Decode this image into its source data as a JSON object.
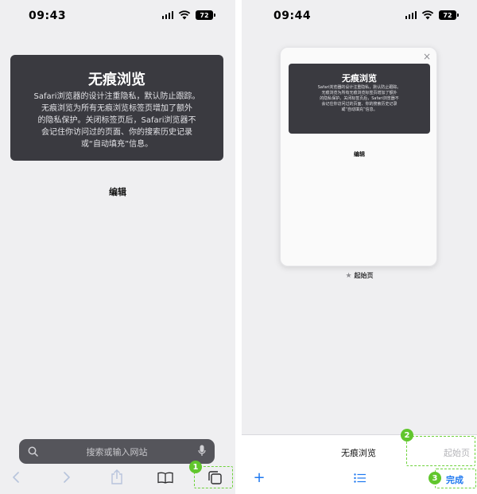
{
  "left": {
    "status": {
      "time": "09:43",
      "battery": "72"
    },
    "card": {
      "title": "无痕浏览",
      "text": "Safari浏览器的设计注重隐私，默认防止跟踪。\n无痕浏览为所有无痕浏览标签页增加了额外\n的隐私保护。关闭标签页后，Safari浏览器不\n会记住你访问过的页面、你的搜索历史记录\n或“自动填充”信息。"
    },
    "edit_label": "编辑",
    "search": {
      "placeholder": "搜索或输入网站"
    },
    "callout": {
      "number": "1"
    }
  },
  "right": {
    "status": {
      "time": "09:44",
      "battery": "72"
    },
    "card": {
      "title": "无痕浏览",
      "text": "Safari浏览器的设计注重隐私，默认防止跟踪。\n无痕浏览为所有无痕浏览标签页增加了额外\n的隐私保护。关闭标签页后，Safari浏览器不\n会记住你访问过的页面、你的搜索历史记录\n或“自动填充”信息。"
    },
    "edit_label": "编辑",
    "close_glyph": "×",
    "star_glyph": "★",
    "start_page_label": "起始页",
    "modes": {
      "private": "无痕浏览",
      "start": "起始页"
    },
    "add_glyph": "+",
    "done_label": "完成",
    "callouts": {
      "start": "2",
      "done": "3"
    }
  },
  "colors": {
    "accent": "#1e78f0",
    "callout": "#61c62d",
    "card": "#3a3a40"
  },
  "icons": {
    "left_toolbar": [
      "back-icon",
      "forward-icon",
      "share-icon",
      "bookmarks-icon",
      "tabs-icon"
    ],
    "right_toolbar": [
      "add-tab-icon",
      "tab-list-icon"
    ]
  }
}
